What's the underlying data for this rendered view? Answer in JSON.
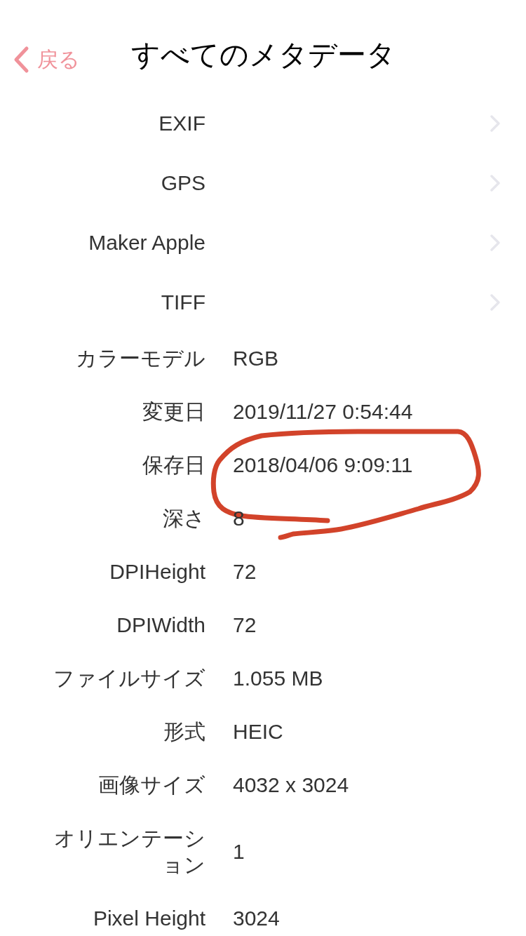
{
  "nav": {
    "back": "戻る",
    "title": "すべてのメタデータ"
  },
  "rows": [
    {
      "kind": "group",
      "label": "EXIF",
      "circled": false
    },
    {
      "kind": "group",
      "label": "GPS",
      "circled": false
    },
    {
      "kind": "group",
      "label": "Maker Apple",
      "circled": false
    },
    {
      "kind": "group",
      "label": "TIFF",
      "circled": false
    },
    {
      "kind": "field",
      "label": "カラーモデル",
      "value": "RGB",
      "circled": false
    },
    {
      "kind": "field",
      "label": "変更日",
      "value": "2019/11/27 0:54:44",
      "circled": false
    },
    {
      "kind": "field",
      "label": "保存日",
      "value": "2018/04/06 9:09:11",
      "circled": true
    },
    {
      "kind": "field",
      "label": "深さ",
      "value": "8",
      "circled": false
    },
    {
      "kind": "field",
      "label": "DPIHeight",
      "value": "72",
      "circled": false
    },
    {
      "kind": "field",
      "label": "DPIWidth",
      "value": "72",
      "circled": false
    },
    {
      "kind": "field",
      "label": "ファイルサイズ",
      "value": "1.055 MB",
      "circled": false
    },
    {
      "kind": "field",
      "label": "形式",
      "value": "HEIC",
      "circled": false
    },
    {
      "kind": "field",
      "label": "画像サイズ",
      "value": "4032 x 3024",
      "circled": false
    },
    {
      "kind": "field",
      "label": "オリエンテーション",
      "value": "1",
      "circled": false
    },
    {
      "kind": "field",
      "label": "Pixel Height",
      "value": "3024",
      "circled": false
    }
  ]
}
